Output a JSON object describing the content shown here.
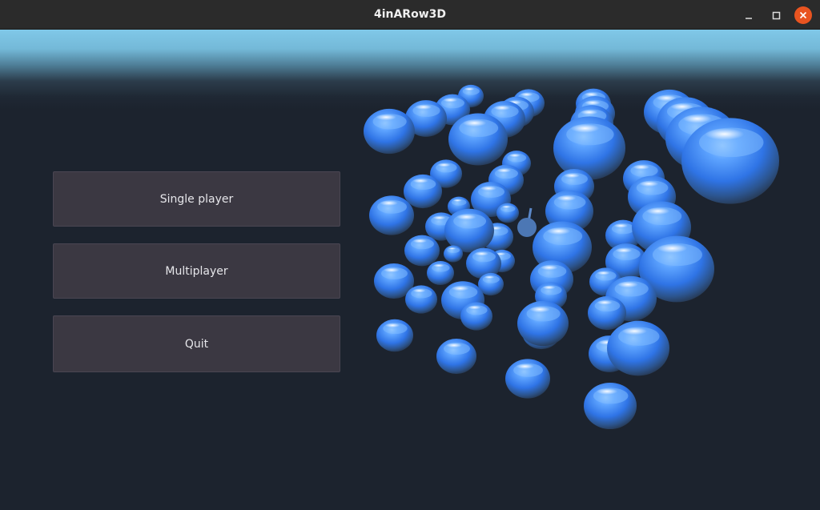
{
  "window": {
    "title": "4inARow3D"
  },
  "menu": {
    "single_player": "Single player",
    "multiplayer": "Multiplayer",
    "quit": "Quit"
  },
  "colors": {
    "sphere": "#3f86ee",
    "sky": "#80c8e8",
    "background": "#1c232e",
    "button": "#3b3842",
    "close_button": "#e95420"
  },
  "icons": [
    "minimize-icon",
    "maximize-icon",
    "close-icon"
  ]
}
